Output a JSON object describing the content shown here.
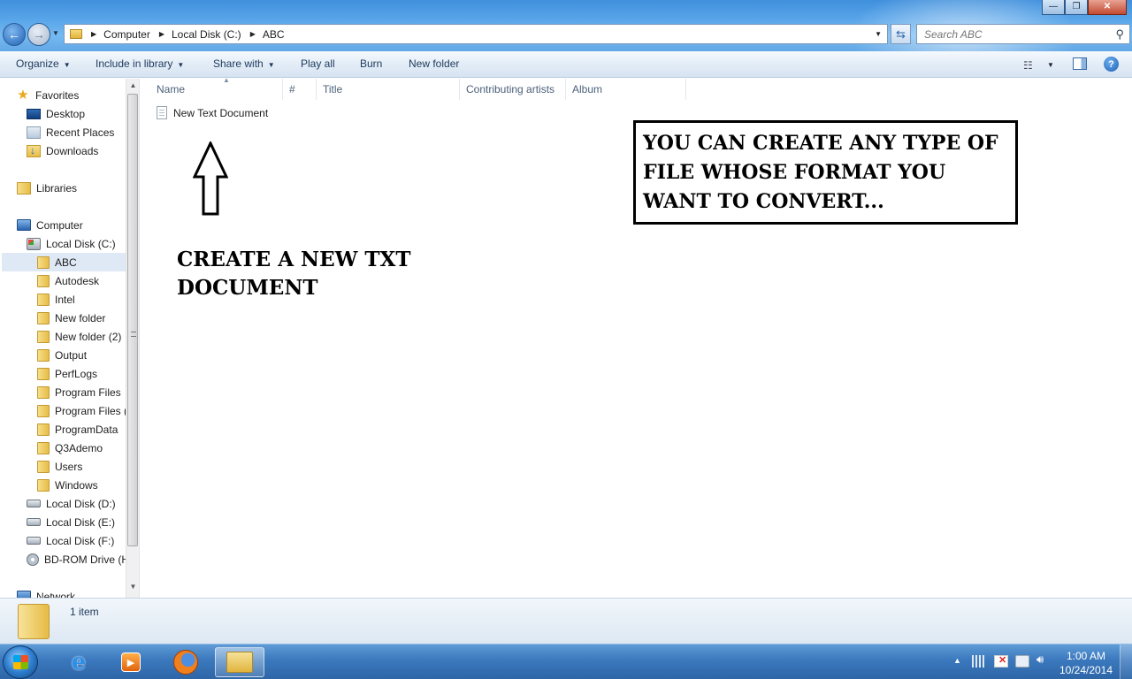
{
  "window": {
    "minimize_glyph": "—",
    "maximize_glyph": "❐",
    "close_glyph": "✕"
  },
  "address": {
    "breadcrumbs": [
      "Computer",
      "Local Disk (C:)",
      "ABC"
    ]
  },
  "search": {
    "placeholder": "Search ABC"
  },
  "toolbar": {
    "items": [
      "Organize",
      "Include in library",
      "Share with",
      "Play all",
      "Burn",
      "New folder"
    ]
  },
  "navigation": {
    "favorites": {
      "label": "Favorites",
      "items": [
        "Desktop",
        "Recent Places",
        "Downloads"
      ]
    },
    "libraries": {
      "label": "Libraries"
    },
    "computer": {
      "label": "Computer",
      "drive_c": "Local Disk (C:)",
      "folders": [
        "ABC",
        "Autodesk",
        "Intel",
        "New folder",
        "New folder (2)",
        "Output",
        "PerfLogs",
        "Program Files",
        "Program Files (",
        "ProgramData",
        "Q3Ademo",
        "Users",
        "Windows"
      ],
      "selected": "ABC",
      "drives": [
        "Local Disk (D:)",
        "Local Disk (E:)",
        "Local Disk (F:)"
      ],
      "optical": "BD-ROM Drive (H"
    },
    "network": {
      "label": "Network"
    }
  },
  "columns": [
    "Name",
    "#",
    "Title",
    "Contributing artists",
    "Album"
  ],
  "files": [
    {
      "name": "New Text Document",
      "icon": "text-file-icon"
    }
  ],
  "annotations": {
    "create_note": "CREATE  A NEW TXT DOCUMENT",
    "callout": "YOU CAN CREATE ANY TYPE OF FILE WHOSE FORMAT YOU WANT TO CONVERT..."
  },
  "details": {
    "item_count": "1 item"
  },
  "taskbar": {
    "pinned": [
      "internet-explorer-icon",
      "media-player-icon",
      "firefox-icon",
      "windows-explorer-icon"
    ],
    "active": "windows-explorer-icon"
  },
  "clock": {
    "time": "1:00 AM",
    "date": "10/24/2014"
  },
  "colors": {
    "title_bar": "#5aa6ea",
    "taskbar": "#3b78bd",
    "selection": "#dfe9f5"
  }
}
